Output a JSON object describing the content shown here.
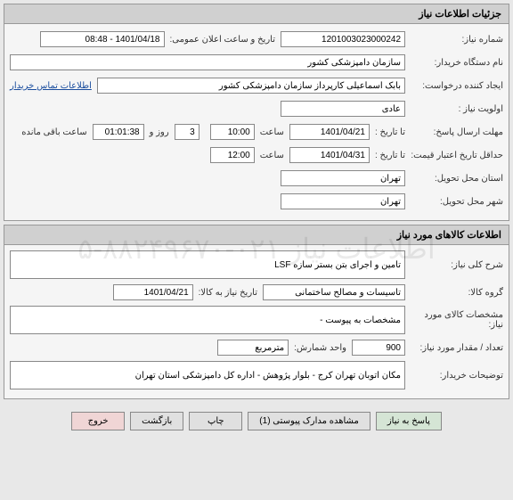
{
  "section1": {
    "title": "جزئیات اطلاعات نیاز",
    "reqnum_label": "شماره نیاز:",
    "reqnum": "1201003023000242",
    "pubdate_label": "تاریخ و ساعت اعلان عمومی:",
    "pubdate": "1401/04/18 - 08:48",
    "buyer_label": "نام دستگاه خریدار:",
    "buyer": "سازمان دامپزشکی کشور",
    "creator_label": "ایجاد کننده درخواست:",
    "creator": "بابک اسماعیلی کارپرداز سازمان دامپزشکی کشور",
    "contact_link": "اطلاعات تماس خریدار",
    "priority_label": "اولویت نیاز :",
    "priority": "عادی",
    "deadline_label": "مهلت ارسال پاسخ:",
    "to_date_label1": "تا تاریخ :",
    "deadline_date": "1401/04/21",
    "time_label": "ساعت",
    "deadline_time": "10:00",
    "days_label": "روز و",
    "days_remain": "3",
    "hours_remain": "01:01:38",
    "hours_label": "ساعت باقی مانده",
    "min_valid_label": "حداقل تاریخ اعتبار قیمت:",
    "to_date_label2": "تا تاریخ :",
    "valid_date": "1401/04/31",
    "valid_time": "12:00",
    "province_label": "استان محل تحویل:",
    "province": "تهران",
    "city_label": "شهر محل تحویل:",
    "city": "تهران"
  },
  "section2": {
    "title": "اطلاعات کالاهای مورد نیاز",
    "desc_label": "شرح کلی نیاز:",
    "desc": "تامین و اجرای بتن بستر سازه LSF",
    "group_label": "گروه کالا:",
    "group": "تاسیسات و مصالح ساختمانی",
    "itemdate_label": "تاریخ نیاز به کالا:",
    "itemdate": "1401/04/21",
    "spec_label": "مشخصات کالای مورد نیاز:",
    "spec": "مشخصات به پیوست -",
    "qty_label": "تعداد / مقدار مورد نیاز:",
    "qty": "900",
    "unit_label": "واحد شمارش:",
    "unit": "مترمربع",
    "notes_label": "توضیحات خریدار:",
    "notes": "مکان اتوبان تهران کرج - بلوار پژوهش - اداره کل دامپزشکی استان تهران"
  },
  "buttons": {
    "respond": "پاسخ به نیاز",
    "attachments": "مشاهده مدارک پیوستی (1)",
    "print": "چاپ",
    "back": "بازگشت",
    "exit": "خروج"
  },
  "watermark": "اطلاعات نیاز ۰۲۱-۸۸۲۴۹۶۷۰-۵"
}
